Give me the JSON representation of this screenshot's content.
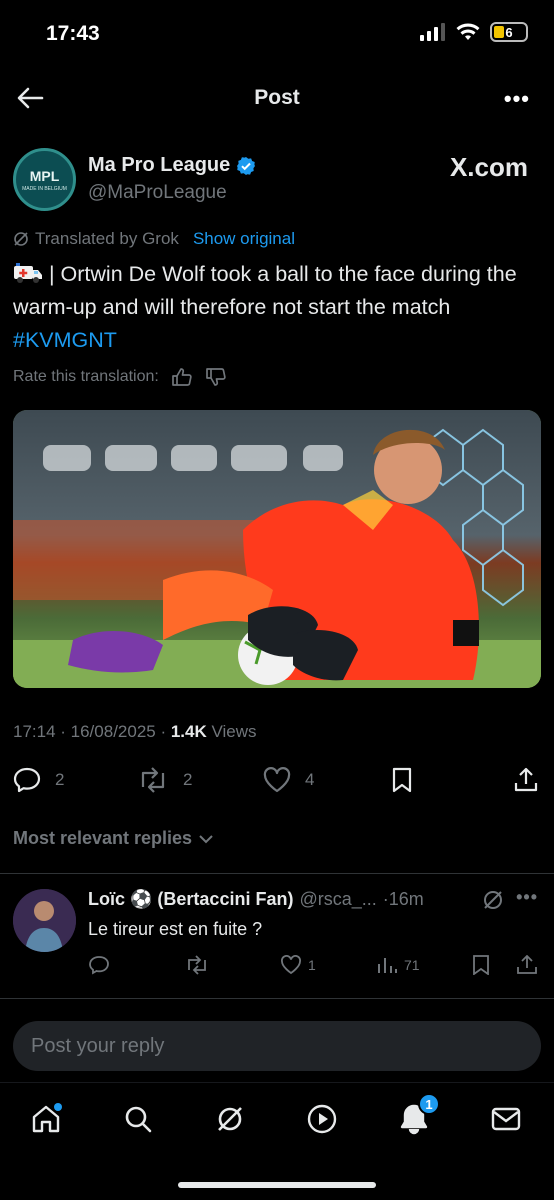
{
  "status_bar": {
    "time": "17:43",
    "battery": "6"
  },
  "header": {
    "title": "Post"
  },
  "post": {
    "avatar_text": "MPL",
    "avatar_subtext": "MADE IN BELGIUM",
    "author_name": "Ma Pro League",
    "author_handle": "@MaProLeague",
    "source_brand": "X.com",
    "translated_label": "Translated by Grok",
    "show_original": "Show original",
    "text_main": " | Ortwin De Wolf took a ball to the face during the warm-up and will therefore not start the match ",
    "hashtag": "#KVMGNT",
    "rate_label": "Rate this translation:",
    "timestamp": "17:14 · 16/08/2025 · ",
    "views_count": "1.4K",
    "views_label": " Views",
    "replies_count": "2",
    "reposts_count": "2",
    "likes_count": "4"
  },
  "replies_section": {
    "label": "Most relevant replies"
  },
  "reply": {
    "name": "Loïc ⚽ (Bertaccini Fan)",
    "handle": "@rsca_...",
    "time": "·16m",
    "text": "Le tireur est en fuite ?",
    "likes": "1",
    "views": "71"
  },
  "compose": {
    "placeholder": "Post your reply"
  },
  "tabbar": {
    "notifications_badge": "1"
  },
  "colors": {
    "accent": "#1d9bf0",
    "muted": "#71767b",
    "text": "#e7e9ea",
    "background": "#000000"
  }
}
